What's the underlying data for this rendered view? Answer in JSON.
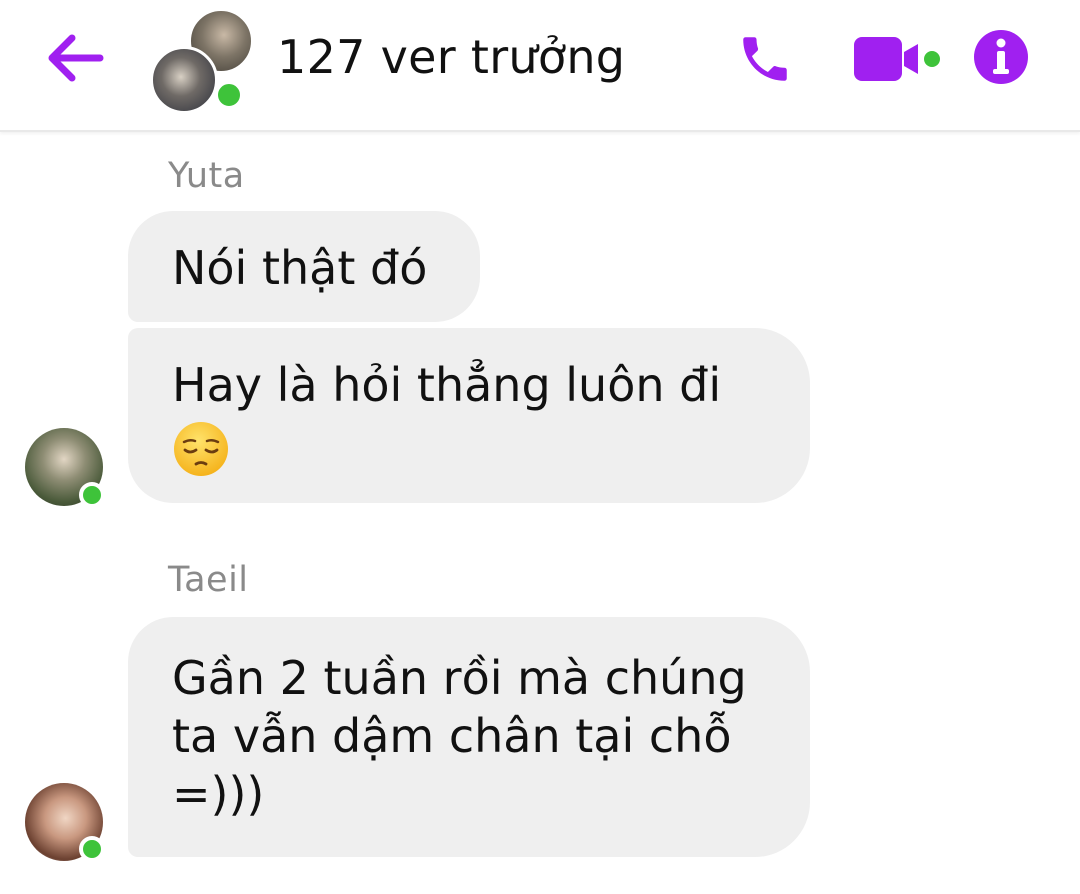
{
  "header": {
    "title": "127 ver trưởng",
    "back_icon": "arrow-left-icon",
    "call_icon": "phone-icon",
    "video_icon": "video-camera-icon",
    "info_icon": "info-icon",
    "accent_color": "#a020f0",
    "online_color": "#3ec33a"
  },
  "messages": [
    {
      "sender": "Yuta",
      "bubbles": [
        "Nói thật đó",
        "Hay là hỏi thẳng luôn đi"
      ],
      "emoji": "pensive-face-icon"
    },
    {
      "sender": "Taeil",
      "bubbles": [
        "Gần 2 tuần rồi mà chúng ta vẫn dậm chân tại chỗ =)))"
      ]
    }
  ]
}
